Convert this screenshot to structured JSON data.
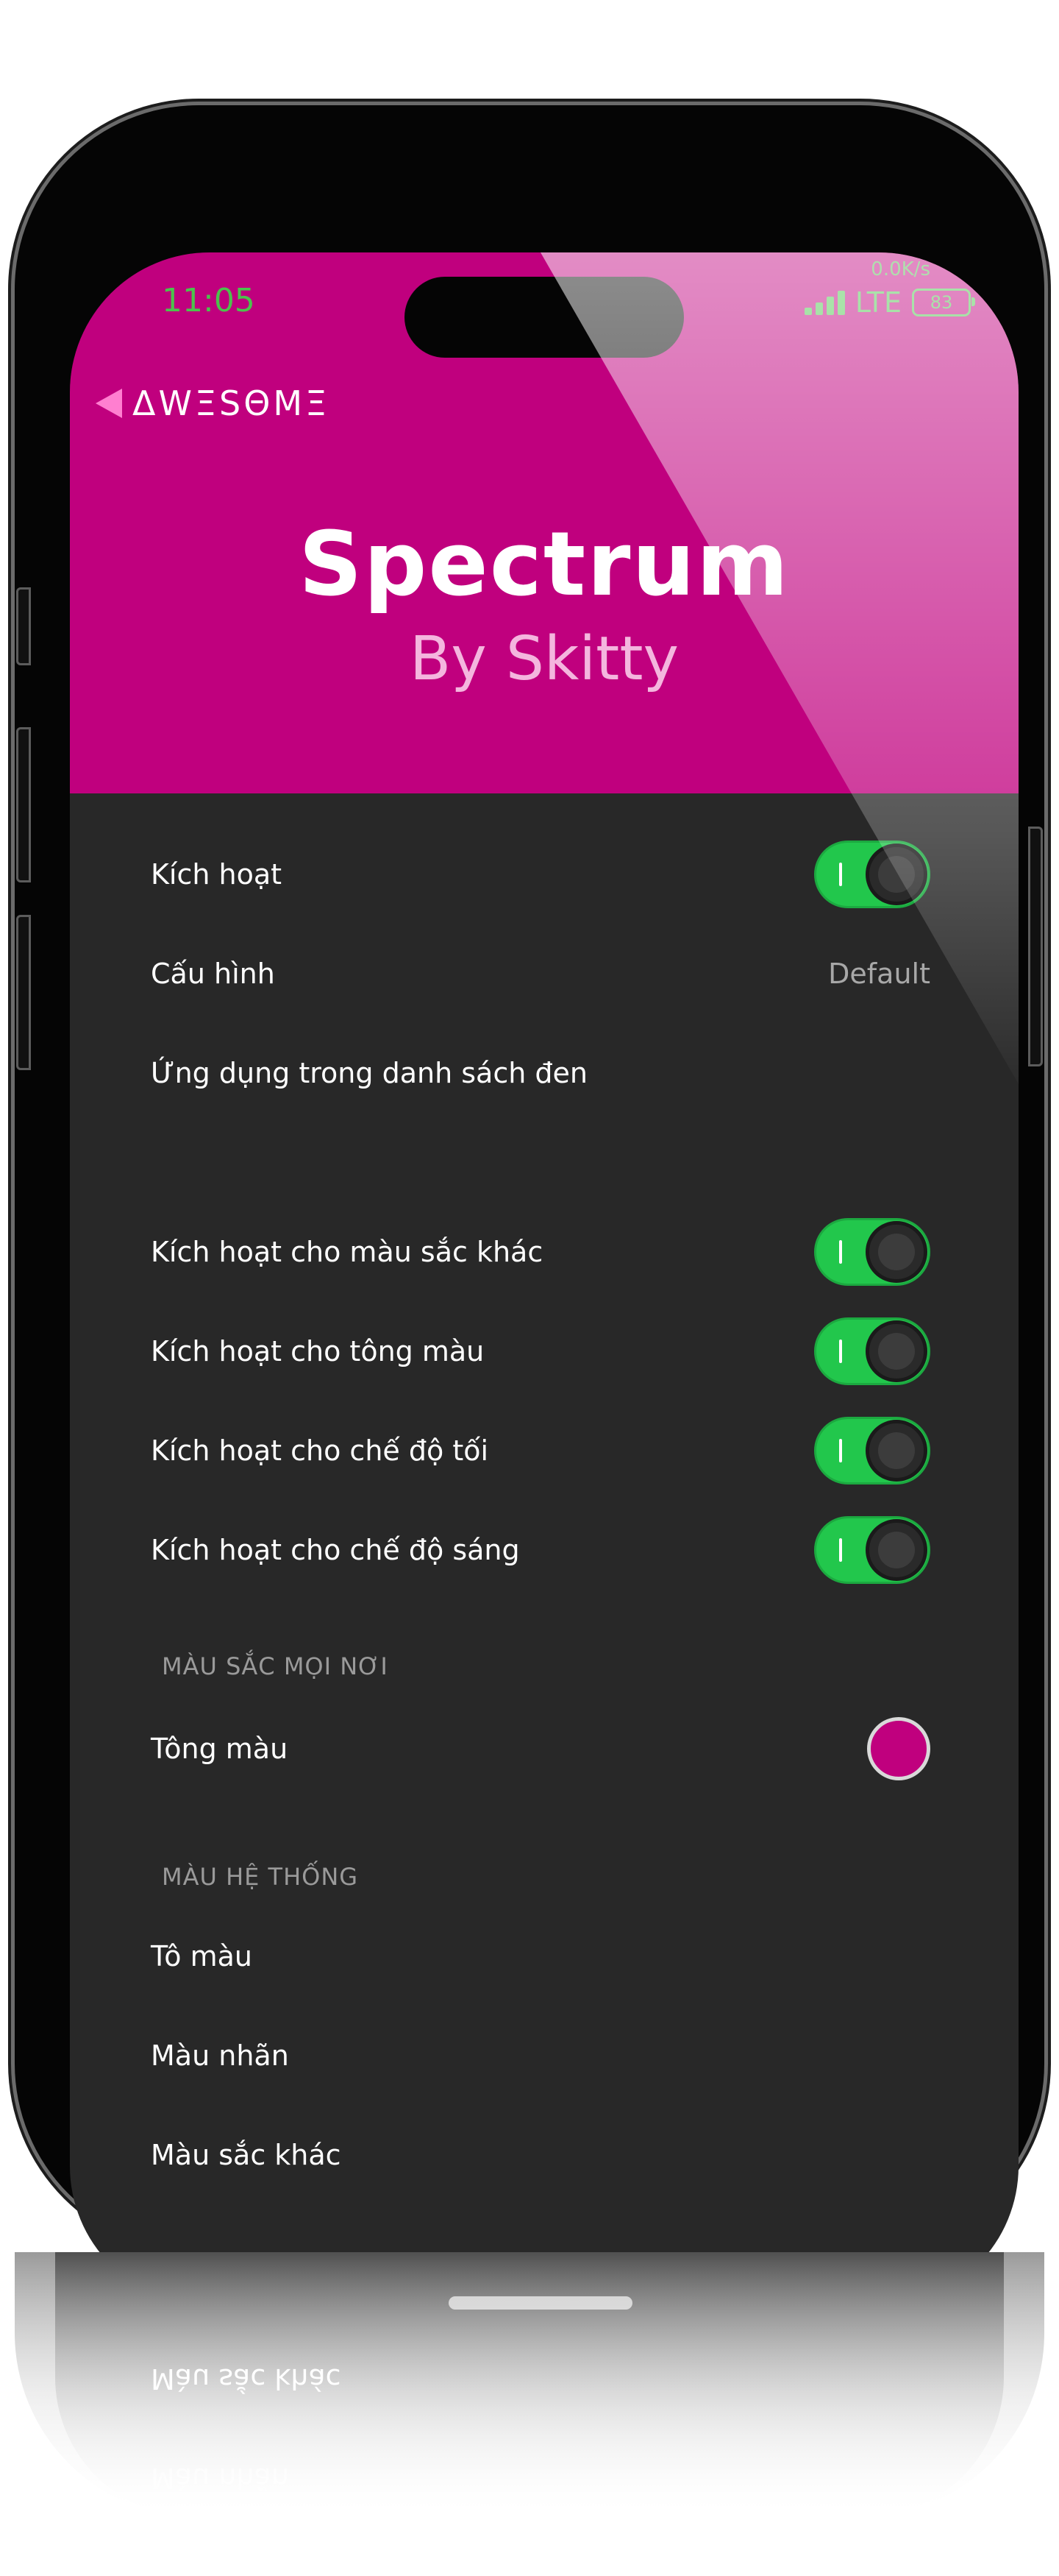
{
  "status_bar": {
    "time": "11:05",
    "net_speed": "0.0K/s",
    "carrier": "LTE",
    "battery": "83"
  },
  "header": {
    "back_label": "ΔWΞSΘMΞ",
    "title": "Spectrum",
    "subtitle": "By Skitty",
    "accent_color": "#c0007e"
  },
  "settings": {
    "enable": {
      "label": "Kích hoạt",
      "on": true
    },
    "config": {
      "label": "Cấu hình",
      "value": "Default"
    },
    "blacklist": {
      "label": "Ứng dụng trong danh sách đen"
    },
    "toggles": [
      {
        "label": "Kích hoạt cho màu sắc khác",
        "on": true
      },
      {
        "label": "Kích hoạt cho tông màu",
        "on": true
      },
      {
        "label": "Kích hoạt cho chế độ tối",
        "on": true
      },
      {
        "label": "Kích hoạt cho chế độ sáng",
        "on": true
      }
    ]
  },
  "everywhere_section": {
    "header": "MÀU SẮC MỌI NƠI",
    "tint": {
      "label": "Tông màu",
      "color": "#c0007e"
    }
  },
  "system_section": {
    "header": "MÀU HỆ THỐNG",
    "items": [
      "Tô màu",
      "Màu nhãn",
      "Màu sắc khác"
    ]
  },
  "toggle_color": "#22c74c"
}
